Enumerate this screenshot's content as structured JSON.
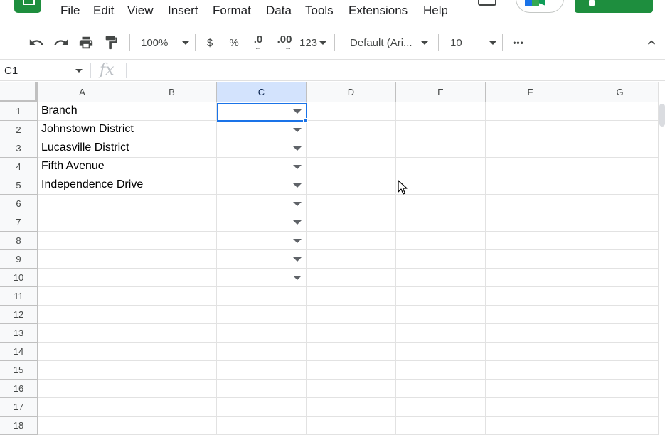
{
  "menu": [
    "File",
    "Edit",
    "View",
    "Insert",
    "Format",
    "Data",
    "Tools",
    "Extensions",
    "Help"
  ],
  "toolbar": {
    "zoom": "100%",
    "currency": "$",
    "percent": "%",
    "decrease_decimal": ".0",
    "increase_decimal": ".00",
    "more_formats": "123",
    "font": "Default (Ari...",
    "font_size": "10",
    "more": "•••"
  },
  "formula_bar": {
    "name_box": "C1",
    "fx": "fx",
    "value": ""
  },
  "columns": [
    "A",
    "B",
    "C",
    "D",
    "E",
    "F",
    "G"
  ],
  "selected_column": "C",
  "rows": [
    "1",
    "2",
    "3",
    "4",
    "5",
    "6",
    "7",
    "8",
    "9",
    "10",
    "11",
    "12",
    "13",
    "14",
    "15",
    "16",
    "17",
    "18"
  ],
  "column_a": [
    "Branch",
    "Johnstown District",
    "Lucasville District",
    "Fifth Avenue",
    "Independence Drive"
  ],
  "dropdown_rows": 10,
  "colors": {
    "brand_green": "#1e8e3e",
    "selection_blue": "#1a73e8",
    "selected_header": "#d3e3fd"
  },
  "icons": [
    "sheets-logo-icon",
    "comment-icon",
    "meet-icon",
    "undo-icon",
    "redo-icon",
    "print-icon",
    "paint-format-icon",
    "chevron-up-icon",
    "fx-icon",
    "dropdown-arrow-icon",
    "mouse-cursor-icon"
  ]
}
